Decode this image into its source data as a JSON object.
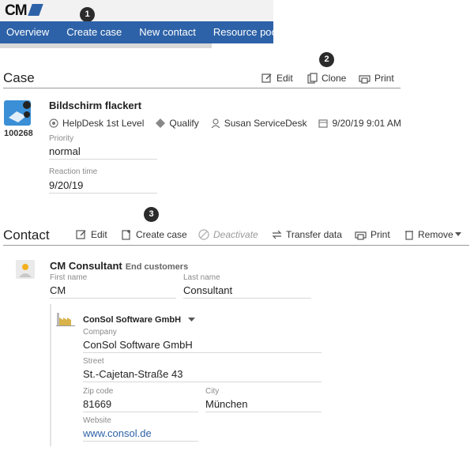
{
  "header": {
    "logo_text": "CM",
    "nav": [
      "Overview",
      "Create case",
      "New contact",
      "Resource pool"
    ],
    "badges": [
      "1",
      "2",
      "3"
    ]
  },
  "case": {
    "section_title": "Case",
    "toolbar": {
      "edit": "Edit",
      "clone": "Clone",
      "print": "Print"
    },
    "id": "100268",
    "title": "Bildschirm flackert",
    "queue": "HelpDesk 1st Level",
    "status": "Qualify",
    "engineer": "Susan ServiceDesk",
    "datetime": "9/20/19 9:01 AM",
    "fields": [
      {
        "label": "Priority",
        "value": "normal"
      },
      {
        "label": "Reaction time",
        "value": "9/20/19"
      }
    ]
  },
  "contact": {
    "section_title": "Contact",
    "toolbar": {
      "edit": "Edit",
      "create_case": "Create case",
      "deactivate": "Deactivate",
      "transfer": "Transfer data",
      "print": "Print",
      "remove": "Remove"
    },
    "name": "CM Consultant",
    "group": "End customers",
    "first_name_label": "First name",
    "first_name": "CM",
    "last_name_label": "Last name",
    "last_name": "Consultant",
    "company": {
      "header": "ConSol Software GmbH",
      "company_label": "Company",
      "company": "ConSol Software GmbH",
      "street_label": "Street",
      "street": "St.-Cajetan-Straße 43",
      "zip_label": "Zip code",
      "zip": "81669",
      "city_label": "City",
      "city": "München",
      "website_label": "Website",
      "website": "www.consol.de"
    }
  },
  "colors": {
    "nav_bg": "#2d62a8",
    "link": "#2d62a8",
    "badge_bg": "#2b2b2b"
  }
}
